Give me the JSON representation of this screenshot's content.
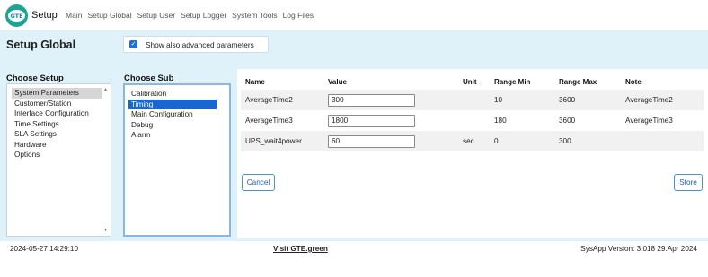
{
  "header": {
    "logo_text": "GTE",
    "app_title": "Setup",
    "nav": [
      "Main",
      "Setup Global",
      "Setup User",
      "Setup Logger",
      "System Tools",
      "Log Files"
    ]
  },
  "page": {
    "title": "Setup Global",
    "advanced_label": "Show also advanced parameters",
    "advanced_checked": true
  },
  "choose_setup": {
    "title": "Choose Setup",
    "items": [
      "System Parameters",
      "Customer/Station",
      "Interface Configuration",
      "Time Settings",
      "SLA Settings",
      "Hardware",
      "Options"
    ],
    "selected": "System Parameters"
  },
  "choose_sub": {
    "title": "Choose Sub",
    "items": [
      "Calibration",
      "Timing",
      "Main Configuration",
      "Debug",
      "Alarm"
    ],
    "selected": "Timing"
  },
  "table": {
    "headers": {
      "name": "Name",
      "value": "Value",
      "unit": "Unit",
      "min": "Range Min",
      "max": "Range Max",
      "note": "Note"
    },
    "rows": [
      {
        "name": "AverageTime2",
        "value": "300",
        "unit": "",
        "min": "10",
        "max": "3600",
        "note": "AverageTime2"
      },
      {
        "name": "AverageTime3",
        "value": "1800",
        "unit": "",
        "min": "180",
        "max": "3600",
        "note": "AverageTime3"
      },
      {
        "name": "UPS_wait4power",
        "value": "60",
        "unit": "sec",
        "min": "0",
        "max": "300",
        "note": ""
      }
    ]
  },
  "buttons": {
    "cancel": "Cancel",
    "store": "Store"
  },
  "footer": {
    "datetime": "2024-05-27 14:29:10",
    "link": "Visit GTE.green",
    "version": "SysApp Version: 3.018 29.Apr 2024"
  },
  "colors": {
    "panel_bg": "#dff1f9",
    "selected_blue": "#1766d1",
    "button_border": "#4a90d9",
    "logo": "#1fa394"
  }
}
